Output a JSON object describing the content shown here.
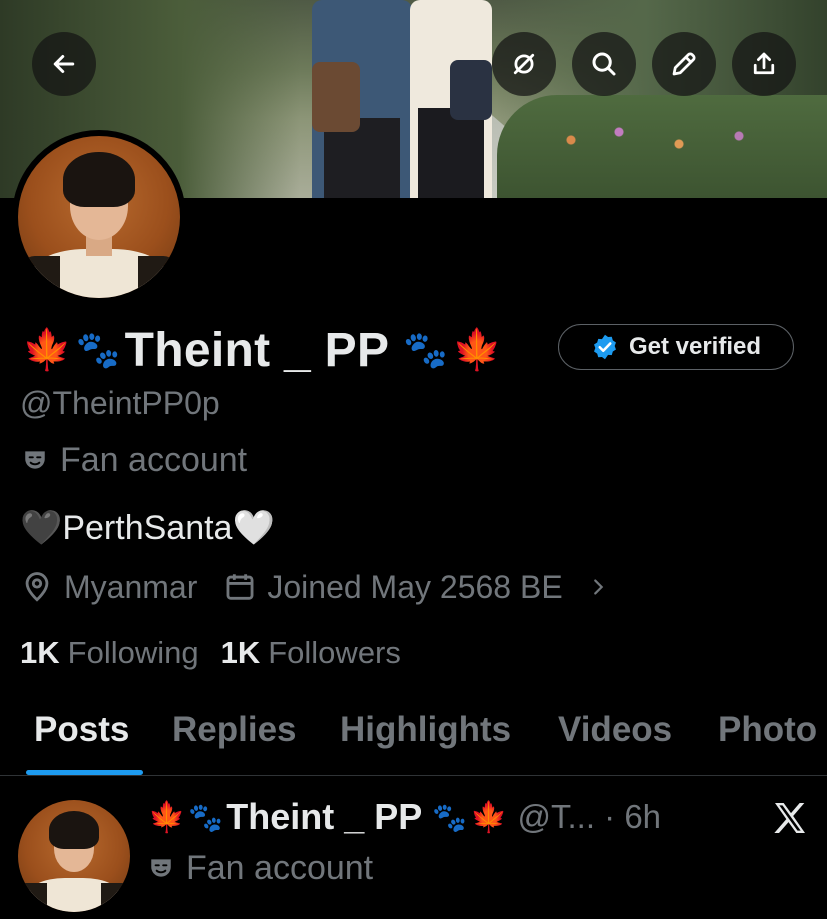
{
  "profile": {
    "display_name": "Theint _ PP",
    "prefix_emoji": "🍁",
    "paws_emoji": "🐾",
    "handle": "@TheintPP0p",
    "account_label": "Fan account",
    "bio_name": "PerthSanta",
    "bio_left_emoji": "🖤",
    "bio_right_emoji": "🤍",
    "location": "Myanmar",
    "joined": "Joined May 2568 BE",
    "following_count": "1K",
    "following_label": "Following",
    "followers_count": "1K",
    "followers_label": "Followers"
  },
  "actions": {
    "get_verified": "Get verified"
  },
  "tabs": [
    {
      "label": "Posts",
      "active": true
    },
    {
      "label": "Replies",
      "active": false
    },
    {
      "label": "Highlights",
      "active": false
    },
    {
      "label": "Videos",
      "active": false
    },
    {
      "label": "Photo",
      "active": false
    }
  ],
  "post": {
    "author_name": "Theint _ PP",
    "handle_time": "@T... · 6h",
    "label": "Fan account"
  },
  "colors": {
    "accent": "#1d9bf0",
    "text_primary": "#e7e9ea",
    "text_secondary": "#71767b",
    "background": "#000000"
  },
  "icons": [
    "back-arrow-icon",
    "no-sync-icon",
    "search-icon",
    "edit-pencil-icon",
    "share-icon",
    "verified-badge-icon",
    "theater-mask-icon",
    "location-pin-icon",
    "calendar-icon",
    "chevron-right-icon",
    "x-logo-icon"
  ]
}
